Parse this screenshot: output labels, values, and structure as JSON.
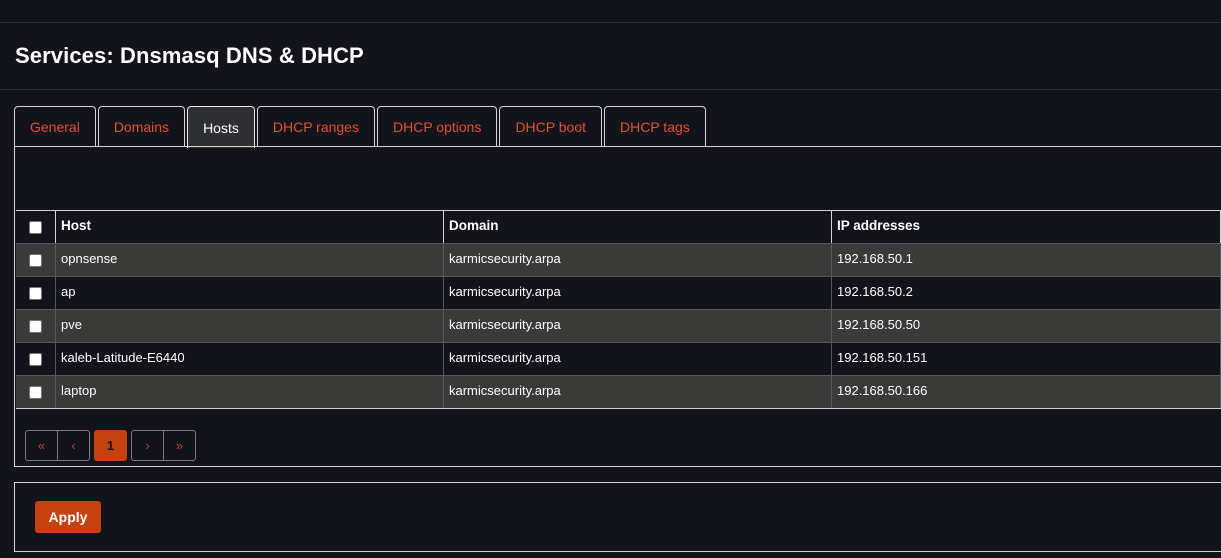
{
  "page": {
    "title": "Services: Dnsmasq DNS & DHCP"
  },
  "tabs": [
    {
      "label": "General"
    },
    {
      "label": "Domains"
    },
    {
      "label": "Hosts",
      "active": true
    },
    {
      "label": "DHCP ranges"
    },
    {
      "label": "DHCP options"
    },
    {
      "label": "DHCP boot"
    },
    {
      "label": "DHCP tags"
    }
  ],
  "table": {
    "columns": [
      "Host",
      "Domain",
      "IP addresses"
    ],
    "rows": [
      {
        "host": "opnsense",
        "domain": "karmicsecurity.arpa",
        "ip": "192.168.50.1",
        "checked": false
      },
      {
        "host": "ap",
        "domain": "karmicsecurity.arpa",
        "ip": "192.168.50.2",
        "checked": false
      },
      {
        "host": "pve",
        "domain": "karmicsecurity.arpa",
        "ip": "192.168.50.50",
        "checked": false
      },
      {
        "host": "kaleb-Latitude-E6440",
        "domain": "karmicsecurity.arpa",
        "ip": "192.168.50.151",
        "checked": false
      },
      {
        "host": "laptop",
        "domain": "karmicsecurity.arpa",
        "ip": "192.168.50.166",
        "checked": false
      }
    ]
  },
  "pager": {
    "first": "«",
    "prev": "‹",
    "current": "1",
    "next": "›",
    "last": "»"
  },
  "actions": {
    "apply_label": "Apply"
  },
  "colors": {
    "accent": "#c5410f",
    "tab_text": "#e0522a",
    "background": "#13141b",
    "row_alt": "#3a3a38"
  }
}
